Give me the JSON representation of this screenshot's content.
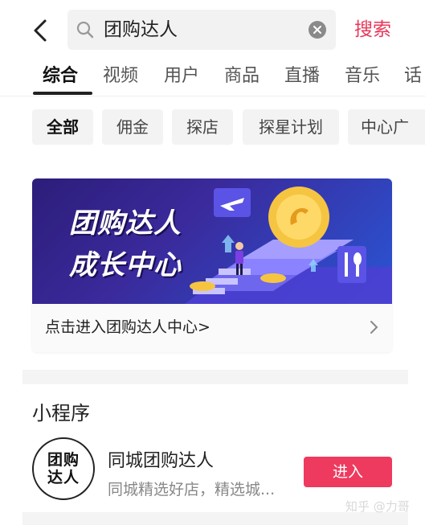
{
  "search": {
    "query": "团购达人",
    "submit_label": "搜索"
  },
  "tabs": [
    {
      "label": "综合",
      "active": true
    },
    {
      "label": "视频",
      "active": false
    },
    {
      "label": "用户",
      "active": false
    },
    {
      "label": "商品",
      "active": false
    },
    {
      "label": "直播",
      "active": false
    },
    {
      "label": "音乐",
      "active": false
    },
    {
      "label": "话",
      "active": false
    }
  ],
  "chips": [
    {
      "label": "全部",
      "active": true
    },
    {
      "label": "佣金",
      "active": false
    },
    {
      "label": "探店",
      "active": false
    },
    {
      "label": "探星计划",
      "active": false
    },
    {
      "label": "中心广",
      "active": false
    }
  ],
  "banner": {
    "title_line1": "团购达人",
    "title_line2": "成长中心",
    "link_text": "点击进入团购达人中心>"
  },
  "mini_programs": {
    "section_title": "小程序",
    "item": {
      "logo_line1": "团购",
      "logo_line2": "达人",
      "name": "同城团购达人",
      "description": "同城精选好店，精选城...",
      "enter_label": "进入"
    }
  },
  "watermark": "知乎 @力哥",
  "colors": {
    "accent": "#e8385b",
    "enter_button": "#ee3a5e",
    "banner_dark": "#2c1d7a",
    "banner_blue": "#2a55d4",
    "coin": "#f5c542"
  },
  "icons": {
    "back": "back-arrow-icon",
    "search": "search-icon",
    "clear": "clear-icon",
    "chevron": "chevron-right-icon"
  }
}
